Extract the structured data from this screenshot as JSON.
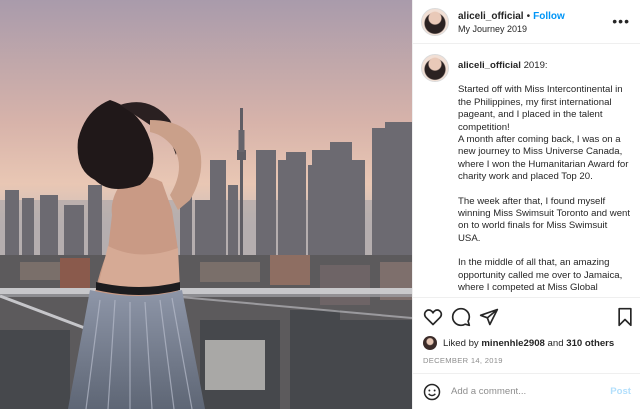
{
  "post": {
    "username": "aliceli_official",
    "separator": "•",
    "follow_label": "Follow",
    "location": "My Journey 2019",
    "more_icon": "more-horizontal-icon"
  },
  "caption": {
    "username": "aliceli_official",
    "title_suffix": " 2019:",
    "paragraphs": [
      "Started off with Miss Intercontinental in the Philippines, my first international pageant, and I placed in the talent competition!",
      "A month after coming back, I was on a new journey to Miss Universe Canada, where I won the Humanitarian Award for charity work and placed Top 20.",
      "The week after that, I found myself winning Miss Swimsuit Toronto and went on to world finals for Miss Swimsuit USA.",
      "In the middle of all that, an amazing opportunity called me over to Jamaica, where I competed at Miss Global International and won my first"
    ]
  },
  "actions": {
    "like_icon": "heart-icon",
    "comment_icon": "comment-icon",
    "share_icon": "paper-plane-icon",
    "save_icon": "bookmark-icon"
  },
  "likes": {
    "prefix": "Liked by ",
    "user": "minenhle2908",
    "middle": " and ",
    "count": "310 others"
  },
  "date": "DECEMBER 14, 2019",
  "comment": {
    "emoji_icon": "smiley-icon",
    "placeholder": "Add a comment...",
    "post_label": "Post"
  },
  "colors": {
    "accent": "#0095f6",
    "post_disabled": "#b2dffc",
    "muted": "#8e8e8e"
  }
}
